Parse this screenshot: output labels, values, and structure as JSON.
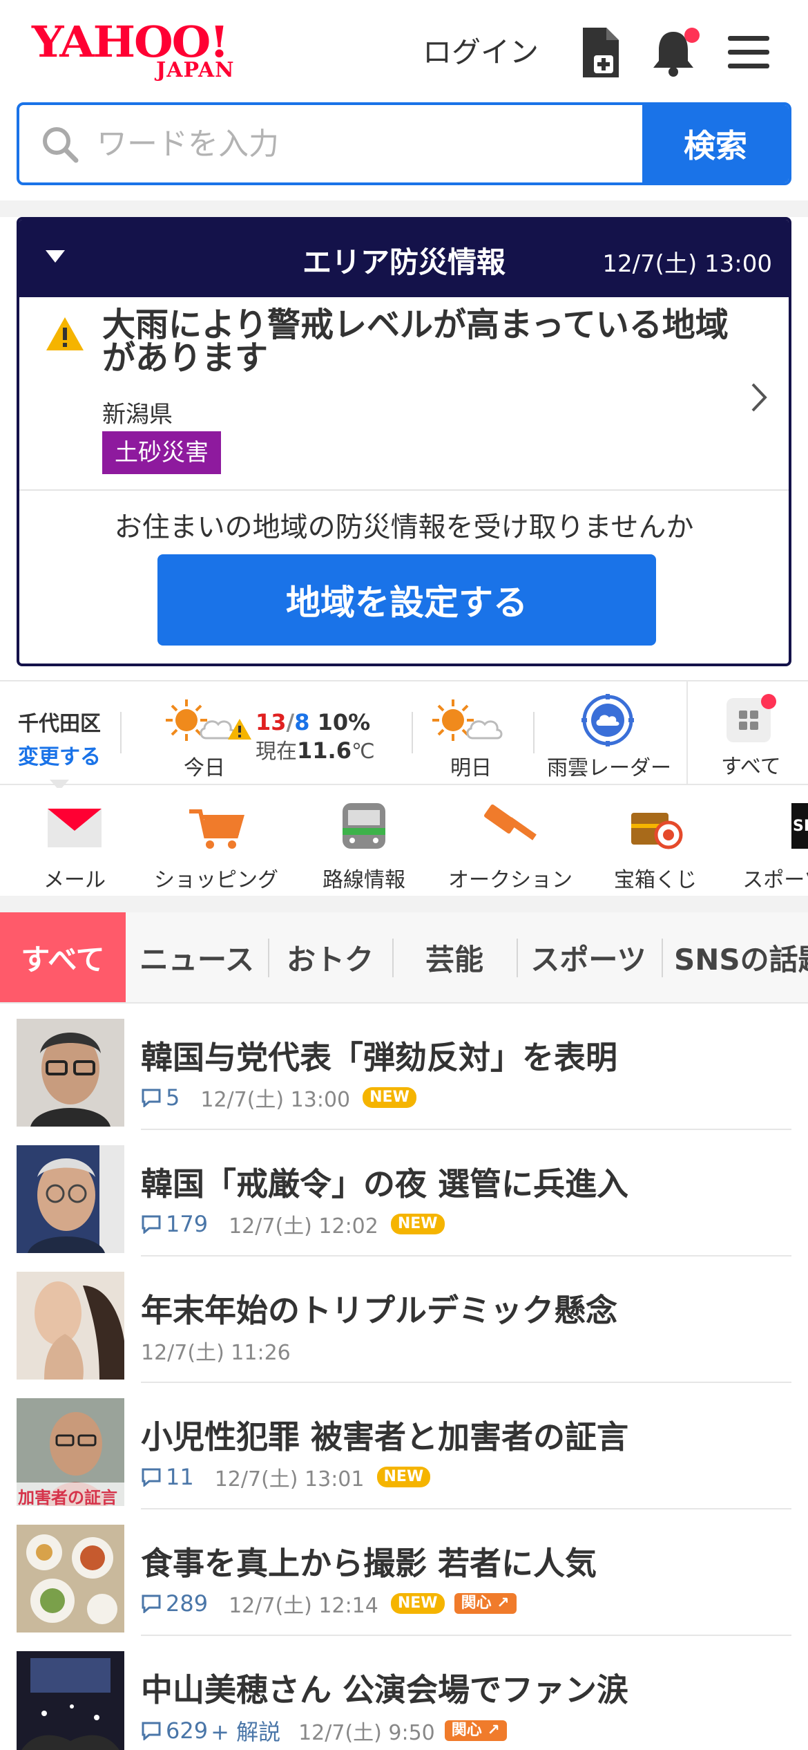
{
  "header": {
    "logo_main": "YAHOO!",
    "logo_sub": "JAPAN",
    "login": "ログイン",
    "colors": {
      "brand": "#ff0033",
      "accent": "#1a73e8"
    }
  },
  "search": {
    "placeholder": "ワードを入力",
    "button": "検索"
  },
  "disaster": {
    "title": "エリア防災情報",
    "date": "12/7(土) 13:00",
    "alert_title": "大雨により警戒レベルが高まっている地域があります",
    "prefecture": "新潟県",
    "tag": "土砂災害",
    "ask": "お住まいの地域の防災情報を受け取りませんか",
    "cta": "地域を設定する"
  },
  "weather": {
    "location": "千代田区",
    "change": "変更する",
    "high": "13",
    "low": "8",
    "rain": "10%",
    "now_label": "現在",
    "now_temp": "11.6",
    "now_unit": "℃",
    "today": "今日",
    "tomorrow": "明日",
    "radar": "雨雲レーダー",
    "all": "すべて"
  },
  "services": [
    {
      "label": "メール",
      "icon": "mail-icon"
    },
    {
      "label": "ショッピング",
      "icon": "cart-icon"
    },
    {
      "label": "路線情報",
      "icon": "train-icon"
    },
    {
      "label": "オークション",
      "icon": "gavel-icon"
    },
    {
      "label": "宝箱くじ",
      "icon": "treasure-icon"
    },
    {
      "label": "スポーツ",
      "icon": "sports-icon"
    }
  ],
  "tabs": [
    "すべて",
    "ニュース",
    "おトク",
    "芸能",
    "スポーツ",
    "SNSの話題"
  ],
  "news": [
    {
      "title": "韓国与党代表「弾劾反対」を表明",
      "comments": "5",
      "time": "12/7(土) 13:00",
      "new": "NEW"
    },
    {
      "title": "韓国「戒厳令」の夜 選管に兵進入",
      "comments": "179",
      "time": "12/7(土) 12:02",
      "new": "NEW"
    },
    {
      "title": "年末年始のトリプルデミック懸念",
      "time": "12/7(土) 11:26"
    },
    {
      "title": "小児性犯罪 被害者と加害者の証言",
      "comments": "11",
      "time": "12/7(土) 13:01",
      "new": "NEW",
      "thumb_caption": "加害者の証言"
    },
    {
      "title": "食事を真上から撮影 若者に人気",
      "comments": "289",
      "time": "12/7(土) 12:14",
      "new": "NEW",
      "hot": "関心"
    },
    {
      "title": "中山美穂さん 公演会場でファン涙",
      "comments": "629",
      "kaisetsu": "+ 解説",
      "time": "12/7(土) 9:50",
      "hot": "関心"
    }
  ]
}
